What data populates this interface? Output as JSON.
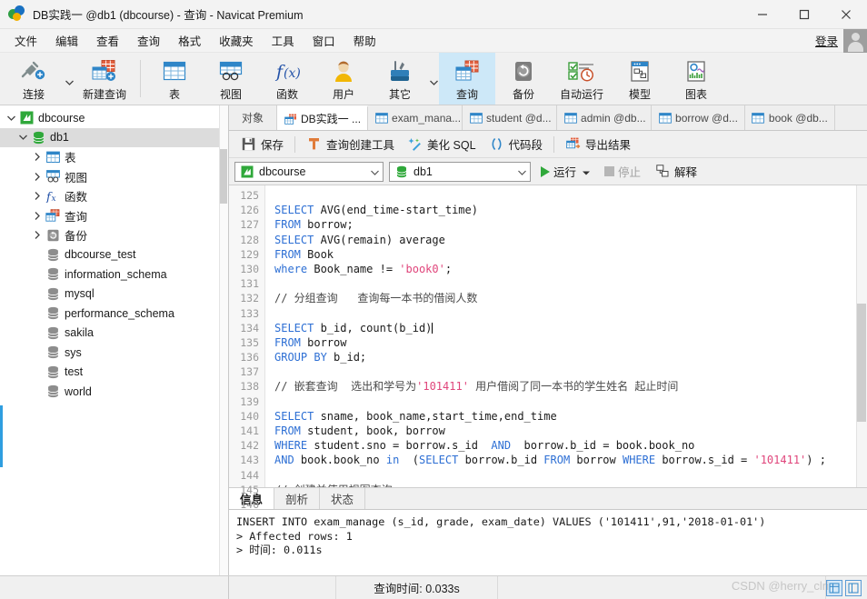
{
  "window": {
    "title": "DB实践一 @db1 (dbcourse) - 查询 - Navicat Premium",
    "logo_icon": "navicat-logo-icon",
    "minimize_icon": "minimize-icon",
    "maximize_icon": "maximize-icon",
    "close_icon": "close-icon"
  },
  "menubar": {
    "items": [
      {
        "label": "文件"
      },
      {
        "label": "编辑"
      },
      {
        "label": "查看"
      },
      {
        "label": "查询"
      },
      {
        "label": "格式"
      },
      {
        "label": "收藏夹"
      },
      {
        "label": "工具"
      },
      {
        "label": "窗口"
      },
      {
        "label": "帮助"
      }
    ],
    "login_label": "登录",
    "avatar_icon": "user-avatar-icon"
  },
  "ribbon": {
    "groups": [
      {
        "items": [
          {
            "label": "连接",
            "icon": "connection-plug-icon",
            "caret": true,
            "selected": false
          },
          {
            "label": "新建查询",
            "icon": "new-query-icon",
            "caret": false,
            "selected": false
          }
        ]
      },
      {
        "items": [
          {
            "label": "表",
            "icon": "table-icon",
            "caret": false,
            "selected": false
          },
          {
            "label": "视图",
            "icon": "view-icon",
            "caret": false,
            "selected": false
          },
          {
            "label": "函数",
            "icon": "function-fx-icon",
            "caret": false,
            "selected": false
          },
          {
            "label": "用户",
            "icon": "user-icon",
            "caret": false,
            "selected": false
          },
          {
            "label": "其它",
            "icon": "other-tools-icon",
            "caret": true,
            "selected": false
          },
          {
            "label": "查询",
            "icon": "query-icon",
            "caret": false,
            "selected": true
          },
          {
            "label": "备份",
            "icon": "backup-icon",
            "caret": false,
            "selected": false
          },
          {
            "label": "自动运行",
            "icon": "automation-icon",
            "caret": false,
            "selected": false
          },
          {
            "label": "模型",
            "icon": "model-icon",
            "caret": false,
            "selected": false
          },
          {
            "label": "图表",
            "icon": "chart-icon",
            "caret": false,
            "selected": false
          }
        ]
      }
    ]
  },
  "sidebar": {
    "items": [
      {
        "label": "dbcourse",
        "indent": 0,
        "twisty": "down",
        "icon": "navicat-connection-icon",
        "selected": false
      },
      {
        "label": "db1",
        "indent": 1,
        "twisty": "down",
        "icon": "database-icon",
        "selected": true
      },
      {
        "label": "表",
        "indent": 2,
        "twisty": "right",
        "icon": "table-icon",
        "selected": false
      },
      {
        "label": "视图",
        "indent": 2,
        "twisty": "right",
        "icon": "view-icon",
        "selected": false
      },
      {
        "label": "函数",
        "indent": 2,
        "twisty": "right",
        "icon": "function-fx-icon",
        "selected": false
      },
      {
        "label": "查询",
        "indent": 2,
        "twisty": "right",
        "icon": "query-icon",
        "selected": false
      },
      {
        "label": "备份",
        "indent": 2,
        "twisty": "right",
        "icon": "backup-icon",
        "selected": false
      },
      {
        "label": "dbcourse_test",
        "indent": 2,
        "twisty": "none",
        "icon": "database-gray-icon",
        "selected": false
      },
      {
        "label": "information_schema",
        "indent": 2,
        "twisty": "none",
        "icon": "database-gray-icon",
        "selected": false
      },
      {
        "label": "mysql",
        "indent": 2,
        "twisty": "none",
        "icon": "database-gray-icon",
        "selected": false
      },
      {
        "label": "performance_schema",
        "indent": 2,
        "twisty": "none",
        "icon": "database-gray-icon",
        "selected": false
      },
      {
        "label": "sakila",
        "indent": 2,
        "twisty": "none",
        "icon": "database-gray-icon",
        "selected": false
      },
      {
        "label": "sys",
        "indent": 2,
        "twisty": "none",
        "icon": "database-gray-icon",
        "selected": false
      },
      {
        "label": "test",
        "indent": 2,
        "twisty": "none",
        "icon": "database-gray-icon",
        "selected": false
      },
      {
        "label": "world",
        "indent": 2,
        "twisty": "none",
        "icon": "database-gray-icon",
        "selected": false
      }
    ]
  },
  "tabstrip": {
    "object_tab": "对象",
    "tabs": [
      {
        "label": "DB实践一 ...",
        "icon": "query-icon",
        "active": true
      },
      {
        "label": "exam_mana...",
        "icon": "table-icon",
        "active": false
      },
      {
        "label": "student @d...",
        "icon": "table-icon",
        "active": false
      },
      {
        "label": "admin @db...",
        "icon": "table-icon",
        "active": false
      },
      {
        "label": "borrow @d...",
        "icon": "table-icon",
        "active": false
      },
      {
        "label": "book @db...",
        "icon": "table-icon",
        "active": false
      }
    ]
  },
  "query_toolbar": {
    "buttons": [
      {
        "label": "保存",
        "icon": "save-icon"
      },
      {
        "label": "查询创建工具",
        "icon": "query-builder-icon"
      },
      {
        "label": "美化 SQL",
        "icon": "beautify-sql-icon"
      },
      {
        "label": "代码段",
        "icon": "code-snippet-icon"
      },
      {
        "label": "导出结果",
        "icon": "export-result-icon"
      }
    ]
  },
  "connection_row": {
    "connection_value": "dbcourse",
    "connection_icon": "navicat-connection-icon",
    "database_value": "db1",
    "database_icon": "database-icon",
    "run_label": "运行",
    "run_icon": "run-play-icon",
    "run_caret_icon": "chevron-down-icon",
    "stop_label": "停止",
    "stop_icon": "stop-square-icon",
    "explain_label": "解释",
    "explain_icon": "explain-icon"
  },
  "editor": {
    "first_line_number": 125,
    "lines": [
      {
        "n": 125,
        "tokens": []
      },
      {
        "n": 126,
        "tokens": [
          {
            "t": "kw",
            "v": "SELECT"
          },
          {
            "t": "plain",
            "v": " AVG(end_time-start_time)"
          }
        ]
      },
      {
        "n": 127,
        "tokens": [
          {
            "t": "kw",
            "v": "FROM"
          },
          {
            "t": "plain",
            "v": " borrow;"
          }
        ]
      },
      {
        "n": 128,
        "tokens": [
          {
            "t": "kw",
            "v": "SELECT"
          },
          {
            "t": "plain",
            "v": " AVG(remain) average"
          }
        ]
      },
      {
        "n": 129,
        "tokens": [
          {
            "t": "kw",
            "v": "FROM"
          },
          {
            "t": "plain",
            "v": " Book"
          }
        ]
      },
      {
        "n": 130,
        "tokens": [
          {
            "t": "kw",
            "v": "where"
          },
          {
            "t": "plain",
            "v": " Book_name != "
          },
          {
            "t": "str",
            "v": "'book0'"
          },
          {
            "t": "plain",
            "v": ";"
          }
        ]
      },
      {
        "n": 131,
        "tokens": []
      },
      {
        "n": 132,
        "tokens": [
          {
            "t": "cmt",
            "v": "// 分组查询   查询每一本书的借阅人数"
          }
        ]
      },
      {
        "n": 133,
        "tokens": []
      },
      {
        "n": 134,
        "tokens": [
          {
            "t": "kw",
            "v": "SELECT"
          },
          {
            "t": "plain",
            "v": " b_id, count(b_id)"
          },
          {
            "t": "caret",
            "v": ""
          }
        ]
      },
      {
        "n": 135,
        "tokens": [
          {
            "t": "kw",
            "v": "FROM"
          },
          {
            "t": "plain",
            "v": " borrow"
          }
        ]
      },
      {
        "n": 136,
        "tokens": [
          {
            "t": "kw",
            "v": "GROUP BY"
          },
          {
            "t": "plain",
            "v": " b_id;"
          }
        ]
      },
      {
        "n": 137,
        "tokens": []
      },
      {
        "n": 138,
        "tokens": [
          {
            "t": "cmt",
            "v": "// 嵌套查询  选出和学号为"
          },
          {
            "t": "str",
            "v": "'101411'"
          },
          {
            "t": "cmt",
            "v": " 用户借阅了同一本书的学生姓名 起止时间"
          }
        ]
      },
      {
        "n": 139,
        "tokens": []
      },
      {
        "n": 140,
        "tokens": [
          {
            "t": "kw",
            "v": "SELECT"
          },
          {
            "t": "plain",
            "v": " sname, book_name,start_time,end_time"
          }
        ]
      },
      {
        "n": 141,
        "tokens": [
          {
            "t": "kw",
            "v": "FROM"
          },
          {
            "t": "plain",
            "v": " student, book, borrow"
          }
        ]
      },
      {
        "n": 142,
        "tokens": [
          {
            "t": "kw",
            "v": "WHERE"
          },
          {
            "t": "plain",
            "v": " student.sno = borrow.s_id  "
          },
          {
            "t": "kw",
            "v": "AND"
          },
          {
            "t": "plain",
            "v": "  borrow.b_id = book.book_no"
          }
        ]
      },
      {
        "n": 143,
        "tokens": [
          {
            "t": "kw",
            "v": "AND"
          },
          {
            "t": "plain",
            "v": " book.book_no "
          },
          {
            "t": "kw",
            "v": "in"
          },
          {
            "t": "plain",
            "v": "  ("
          },
          {
            "t": "kw",
            "v": "SELECT"
          },
          {
            "t": "plain",
            "v": " borrow.b_id "
          },
          {
            "t": "kw",
            "v": "FROM"
          },
          {
            "t": "plain",
            "v": " borrow "
          },
          {
            "t": "kw",
            "v": "WHERE"
          },
          {
            "t": "plain",
            "v": " borrow.s_id = "
          },
          {
            "t": "str",
            "v": "'101411'"
          },
          {
            "t": "plain",
            "v": ") ;"
          }
        ]
      },
      {
        "n": 144,
        "tokens": []
      },
      {
        "n": 145,
        "tokens": [
          {
            "t": "cmt",
            "v": "// 创建并使用视图查询"
          }
        ]
      },
      {
        "n": 146,
        "tokens": []
      }
    ]
  },
  "results": {
    "tabs": [
      {
        "label": "信息",
        "active": true
      },
      {
        "label": "剖析",
        "active": false
      },
      {
        "label": "状态",
        "active": false
      }
    ],
    "lines": [
      "INSERT INTO exam_manage (s_id, grade, exam_date) VALUES ('101411',91,'2018-01-01')",
      "> Affected rows: 1",
      "> 时间: 0.011s"
    ]
  },
  "statusbar": {
    "query_time_label": "查询时间: 0.033s",
    "watermark": "CSDN @herry_clri",
    "grid_view_icon": "grid-view-icon",
    "form_view_icon": "form-view-icon"
  }
}
